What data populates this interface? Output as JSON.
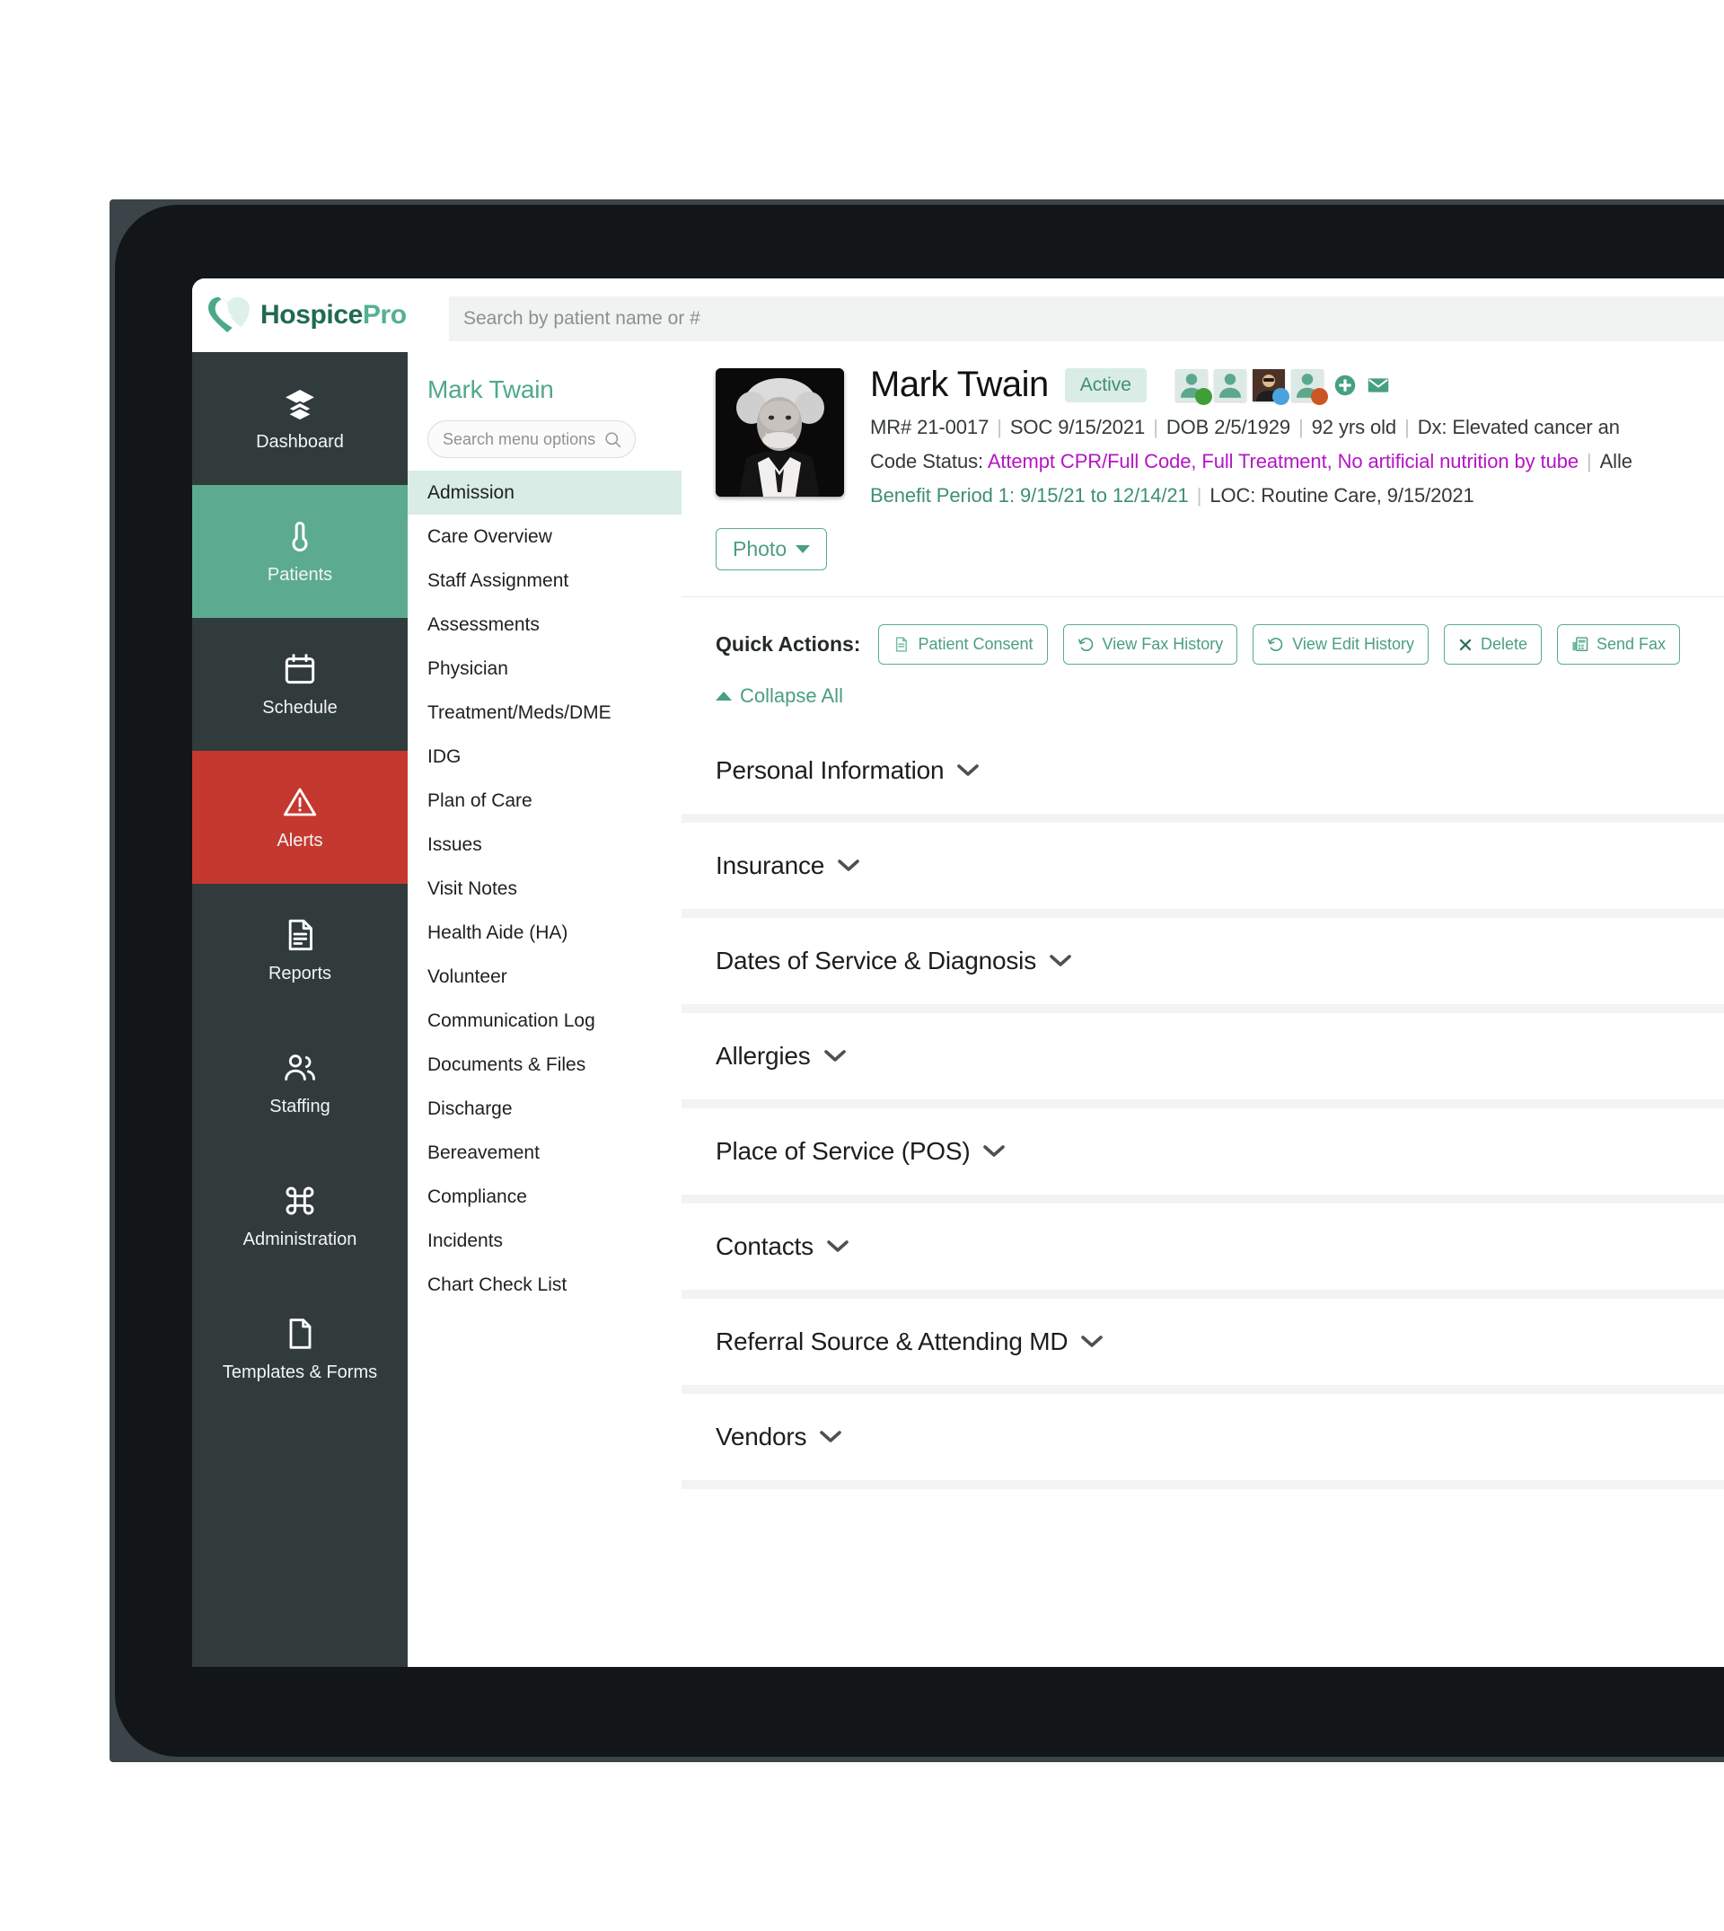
{
  "brand": {
    "name_primary": "Hospice",
    "name_secondary": "Pro",
    "logo_icon": "heart-hand-icon"
  },
  "topbar": {
    "search_placeholder": "Search by patient name or #",
    "search_value": ""
  },
  "rail": {
    "items": [
      {
        "label": "Dashboard",
        "icon": "layers-icon",
        "state": "default"
      },
      {
        "label": "Patients",
        "icon": "thermometer-icon",
        "state": "active-green"
      },
      {
        "label": "Schedule",
        "icon": "calendar-icon",
        "state": "default"
      },
      {
        "label": "Alerts",
        "icon": "alert-triangle-icon",
        "state": "active-red"
      },
      {
        "label": "Reports",
        "icon": "document-lines-icon",
        "state": "default"
      },
      {
        "label": "Staffing",
        "icon": "people-icon",
        "state": "default"
      },
      {
        "label": "Administration",
        "icon": "command-icon",
        "state": "default"
      },
      {
        "label": "Templates & Forms",
        "icon": "file-icon",
        "state": "default"
      }
    ]
  },
  "submenu": {
    "title": "Mark Twain",
    "search_placeholder": "Search menu options",
    "search_icon": "search-icon",
    "items": [
      {
        "label": "Admission",
        "selected": true
      },
      {
        "label": "Care Overview",
        "selected": false
      },
      {
        "label": "Staff Assignment",
        "selected": false
      },
      {
        "label": "Assessments",
        "selected": false
      },
      {
        "label": "Physician",
        "selected": false
      },
      {
        "label": "Treatment/Meds/DME",
        "selected": false
      },
      {
        "label": "IDG",
        "selected": false
      },
      {
        "label": "Plan of Care",
        "selected": false
      },
      {
        "label": "Issues",
        "selected": false
      },
      {
        "label": "Visit Notes",
        "selected": false
      },
      {
        "label": "Health Aide (HA)",
        "selected": false
      },
      {
        "label": "Volunteer",
        "selected": false
      },
      {
        "label": "Communication Log",
        "selected": false
      },
      {
        "label": "Documents & Files",
        "selected": false
      },
      {
        "label": "Discharge",
        "selected": false
      },
      {
        "label": "Bereavement",
        "selected": false
      },
      {
        "label": "Compliance",
        "selected": false
      },
      {
        "label": "Incidents",
        "selected": false
      },
      {
        "label": "Chart Check List",
        "selected": false
      }
    ]
  },
  "patient": {
    "name": "Mark Twain",
    "status_badge": "Active",
    "photo_alt": "patient-photo",
    "mrn": "MR# 21-0017",
    "soc": "SOC 9/15/2021",
    "dob": "DOB 2/5/1929",
    "age": "92 yrs old",
    "dx": "Dx: Elevated cancer an",
    "code_status_label": "Code Status:",
    "code_status_value": "Attempt CPR/Full Code, Full Treatment, No artificial nutrition by tube",
    "allergies_label": "Alle",
    "benefit_period": "Benefit Period 1: 9/15/21 to 12/14/21",
    "loc": "LOC: Routine Care, 9/15/2021",
    "photo_button": "Photo",
    "care_team": [
      {
        "icon": "person-icon",
        "dot_color": "#3f9e37"
      },
      {
        "icon": "person-icon",
        "dot_color": "#ffffff"
      },
      {
        "icon": "person-photo-icon",
        "dot_color": "#4aa3dd"
      },
      {
        "icon": "person-icon",
        "dot_color": "#cc5524"
      }
    ],
    "add_icon": "plus-circle-icon",
    "mail_icon": "envelope-icon"
  },
  "quick_actions": {
    "label": "Quick Actions:",
    "buttons": [
      {
        "label": "Patient Consent",
        "icon": "document-icon"
      },
      {
        "label": "View Fax History",
        "icon": "history-icon"
      },
      {
        "label": "View Edit History",
        "icon": "history-icon"
      },
      {
        "label": "Delete",
        "icon": "x-icon"
      },
      {
        "label": "Send Fax",
        "icon": "fax-icon"
      }
    ],
    "collapse_all": "Collapse All",
    "collapse_icon": "chevron-up-icon"
  },
  "sections": [
    {
      "title": "Personal Information",
      "caret": "chevron-down-icon"
    },
    {
      "title": "Insurance",
      "caret": "chevron-down-icon"
    },
    {
      "title": "Dates of Service & Diagnosis",
      "caret": "chevron-down-icon"
    },
    {
      "title": "Allergies",
      "caret": "chevron-down-icon"
    },
    {
      "title": "Place of Service (POS)",
      "caret": "chevron-down-icon"
    },
    {
      "title": "Contacts",
      "caret": "chevron-down-icon"
    },
    {
      "title": "Referral Source & Attending MD",
      "caret": "chevron-down-icon"
    },
    {
      "title": "Vendors",
      "caret": "chevron-down-icon"
    }
  ],
  "colors": {
    "brand_dark_green": "#1f6a52",
    "brand_green": "#53b193",
    "accent_green": "#5cab90",
    "alert_red": "#c4382f",
    "rail_bg": "#323b3b",
    "code_status_purple": "#b415c5",
    "selected_menu_bg": "#d9ece5"
  }
}
